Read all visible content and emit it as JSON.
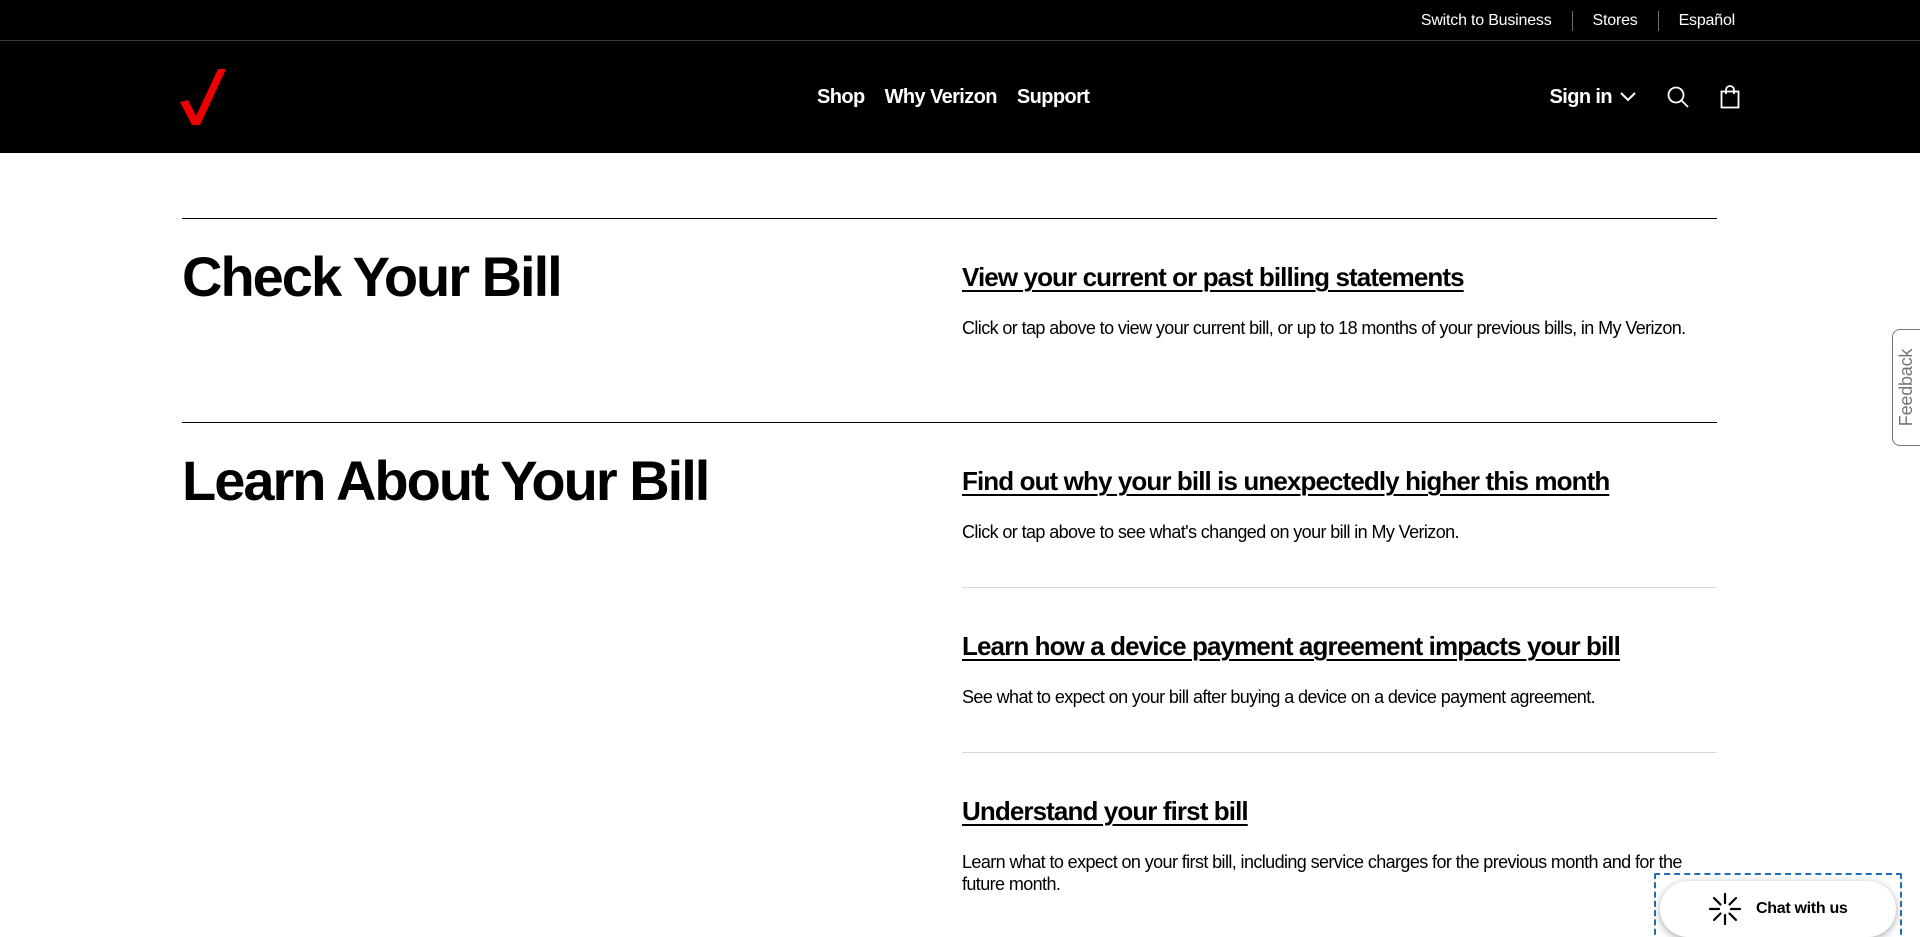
{
  "utility": {
    "links": [
      "Switch to Business",
      "Stores",
      "Español"
    ]
  },
  "header": {
    "logo_alt": "Verizon",
    "nav": [
      "Shop",
      "Why Verizon",
      "Support"
    ],
    "signin_label": "Sign in"
  },
  "sections": [
    {
      "title": "Check Your Bill",
      "links": [
        {
          "title": "View your current or past billing statements",
          "desc": "Click or tap above to view your current bill, or up to 18 months of your previous bills, in My Verizon."
        }
      ]
    },
    {
      "title": "Learn About Your Bill",
      "links": [
        {
          "title": "Find out why your bill is unexpectedly higher this month",
          "desc": "Click or tap above to see what's changed on your bill in My Verizon."
        },
        {
          "title": "Learn how a device payment agreement impacts your bill",
          "desc": "See what to expect on your bill after buying a device on a device payment agreement."
        },
        {
          "title": "Understand your first bill",
          "desc": "Learn what to expect on your first bill, including service charges for the previous month and for the future month."
        }
      ]
    }
  ],
  "feedback": {
    "label": "Feedback"
  },
  "chat": {
    "label": "Chat with us"
  },
  "colors": {
    "brand_red": "#ee0000",
    "header_bg": "#000000",
    "focus_ring": "#1f6fb5"
  }
}
